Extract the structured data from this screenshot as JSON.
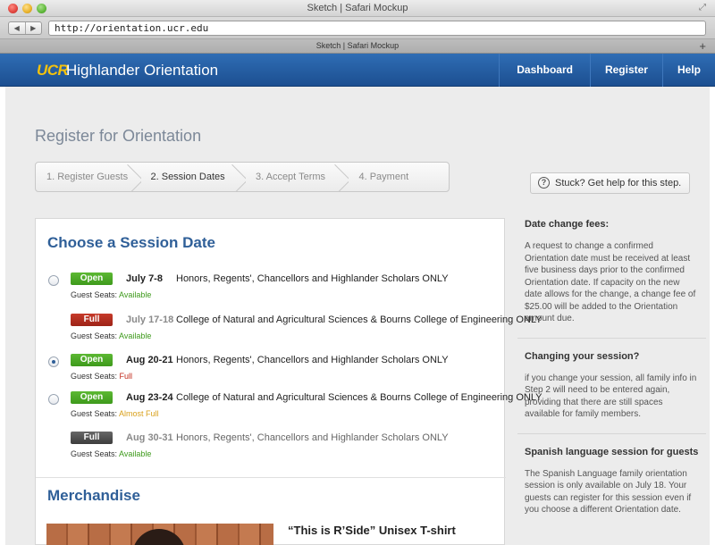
{
  "window": {
    "title": "Sketch | Safari Mockup",
    "url": "http://orientation.ucr.edu",
    "tab_title": "Sketch | Safari Mockup",
    "back_glyph": "◀",
    "forward_glyph": "▶",
    "tab_add_glyph": "+",
    "resize_glyph": "⤢"
  },
  "header": {
    "logo": "UCR",
    "title": "Highlander Orientation",
    "nav": [
      "Dashboard",
      "Register",
      "Help"
    ],
    "brand_color": "#1c4f91",
    "logo_color": "#f4c20d"
  },
  "page": {
    "title": "Register for Orientation",
    "steps": [
      "1. Register Guests",
      "2. Session Dates",
      "3. Accept Terms",
      "4. Payment"
    ],
    "active_step": 2,
    "help_button": "Stuck? Get help for this step.",
    "help_icon": "?"
  },
  "sessions": {
    "heading": "Choose a Session Date",
    "guest_seats_label": "Guest Seats:",
    "items": [
      {
        "status": "Open",
        "date": "July 7-8",
        "description": "Honors, Regents', Chancellors and Highlander Scholars ONLY",
        "seats": "Available",
        "selectable": true,
        "selected": false
      },
      {
        "status": "Full",
        "date": "July 17-18",
        "description": "College of Natural and Agricultural Sciences & Bourns College of Engineering ONLY",
        "seats": "Available",
        "selectable": false,
        "selected": false
      },
      {
        "status": "Open",
        "date": "Aug 20-21",
        "description": "Honors, Regents', Chancellors and Highlander Scholars ONLY",
        "seats": "Full",
        "selectable": true,
        "selected": true
      },
      {
        "status": "Open",
        "date": "Aug 23-24",
        "description": "College of Natural and Agricultural Sciences & Bourns College of Engineering ONLY",
        "seats": "Almost Full",
        "selectable": true,
        "selected": false
      },
      {
        "status": "Full",
        "date": "Aug 30-31",
        "description": "Honors, Regents', Chancellors and Highlander Scholars ONLY",
        "seats": "Available",
        "selectable": false,
        "selected": false
      }
    ]
  },
  "merchandise": {
    "heading": "Merchandise",
    "item_name": "“This is R’Side” Unisex T-shirt"
  },
  "sidebar": [
    {
      "title": "Date change fees:",
      "text": "A request to change a confirmed Orientation date must be received at least five business days prior to the confirmed Orientation date. If capacity on the new date allows for the change, a change fee of $25.00 will be added to the Orientation amount due."
    },
    {
      "title": "Changing your session?",
      "text": "if you change your session, all family info in Step 2 will need to be entered again, providing that there are still spaces available for family members."
    },
    {
      "title": "Spanish language session for guests",
      "text": "The Spanish Language family orientation session is only available on July 18. Your guests can register for this session even if you choose a different Orientation date."
    }
  ],
  "colors": {
    "open": "#3e9a1c",
    "full_red": "#9d2317",
    "full_dark": "#3c3c3c",
    "heading_blue": "#2f5f98"
  }
}
